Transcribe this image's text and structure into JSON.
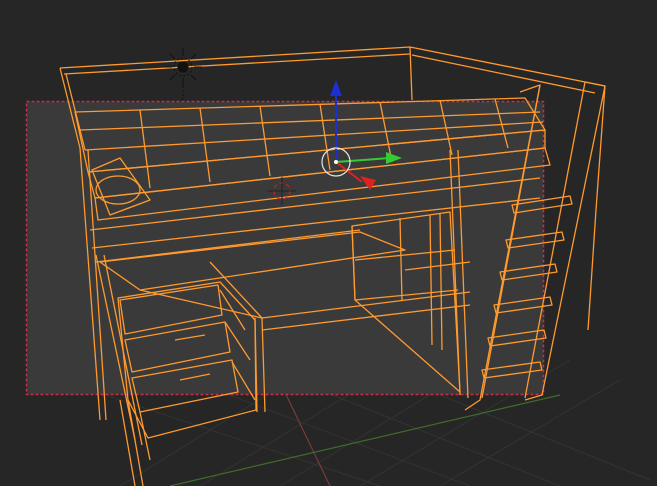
{
  "viewport": {
    "background_color": "#262626",
    "camera_frame_fill": "#3a3a3a",
    "camera_frame_border_color": "#c2314d",
    "grid_color": "#333333",
    "x_axis_color": "#7a3a3a",
    "y_axis_color": "#3f6b2c",
    "wireframe_color": "#ff9a2e",
    "wireframe_dim_color": "#d98426"
  },
  "gizmo": {
    "z_axis_color": "#1d2fcc",
    "y_axis_color": "#33cc33",
    "x_axis_color": "#dd2222",
    "pivot_ring_color": "#e8e8e8"
  },
  "light_icon": "sun-lamp-icon",
  "cursor_icon": "3d-cursor-icon"
}
